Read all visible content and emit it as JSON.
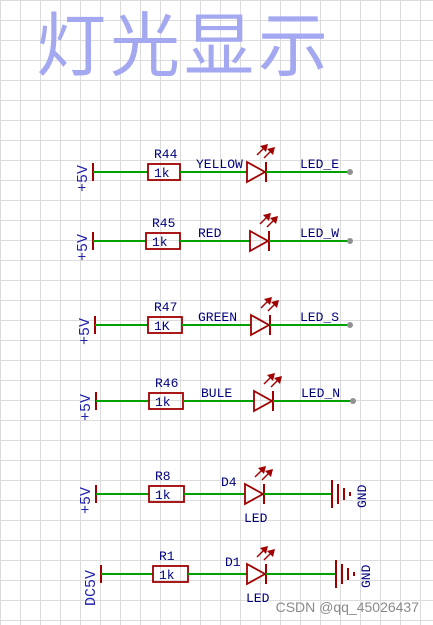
{
  "title": "灯光显示",
  "colors": {
    "title": "#a3a8f0",
    "wire": "#00a000",
    "component": "#a00000",
    "label": "#000080",
    "power": "#2020b0",
    "pin": "#909090"
  },
  "circuits": [
    {
      "power": "+5V",
      "ref": "R44",
      "value": "1k",
      "color_label": "YELLOW",
      "net": "LED_E",
      "kind": "net"
    },
    {
      "power": "+5V",
      "ref": "R45",
      "value": "1k",
      "color_label": "RED",
      "net": "LED_W",
      "kind": "net"
    },
    {
      "power": "+5V",
      "ref": "R47",
      "value": "1K",
      "color_label": "GREEN",
      "net": "LED_S",
      "kind": "net"
    },
    {
      "power": "+5V",
      "ref": "R46",
      "value": "1k",
      "color_label": "BULE",
      "net": "LED_N",
      "kind": "net"
    },
    {
      "power": "+5V",
      "ref": "R8",
      "value": "1k",
      "diode_ref": "D4",
      "diode_value": "LED",
      "ground": "GND",
      "kind": "gnd"
    },
    {
      "power": "DC5V",
      "ref": "R1",
      "value": "1k",
      "diode_ref": "D1",
      "diode_value": "LED",
      "ground": "GND",
      "kind": "gnd"
    }
  ],
  "watermark": "CSDN @qq_45026437"
}
